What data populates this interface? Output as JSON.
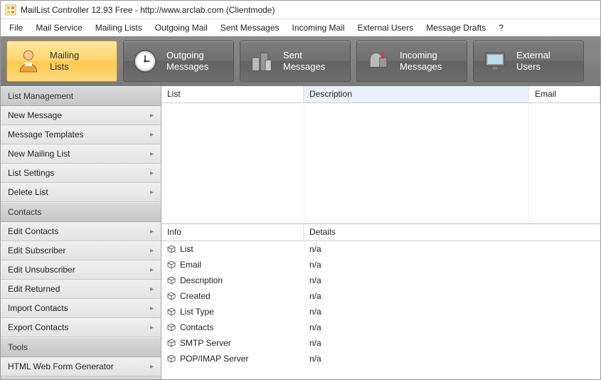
{
  "window": {
    "title": "MailList Controller 12.93 Free - http://www.arclab.com (Clientmode)"
  },
  "menubar": [
    "File",
    "Mail Service",
    "Mailing Lists",
    "Outgoing Mail",
    "Sent Messages",
    "Incoming Mail",
    "External Users",
    "Message Drafts",
    "?"
  ],
  "toolbar": [
    {
      "id": "mailing-lists",
      "line1": "Mailing",
      "line2": "Lists",
      "active": true
    },
    {
      "id": "outgoing-messages",
      "line1": "Outgoing",
      "line2": "Messages",
      "active": false
    },
    {
      "id": "sent-messages",
      "line1": "Sent",
      "line2": "Messages",
      "active": false
    },
    {
      "id": "incoming-messages",
      "line1": "Incoming",
      "line2": "Messages",
      "active": false
    },
    {
      "id": "external-users",
      "line1": "External",
      "line2": "Users",
      "active": false
    }
  ],
  "sidebar": {
    "sections": [
      {
        "header": "List Management",
        "items": [
          "New Message",
          "Message Templates",
          "New Mailing List",
          "List Settings",
          "Delete List"
        ]
      },
      {
        "header": "Contacts",
        "items": [
          "Edit Contacts",
          "Edit Subscriber",
          "Edit Unsubscriber",
          "Edit Returned",
          "Import Contacts",
          "Export Contacts"
        ]
      },
      {
        "header": "Tools",
        "items": [
          "HTML Web Form Generator"
        ]
      }
    ]
  },
  "table": {
    "columns": [
      "List",
      "Description",
      "Email"
    ]
  },
  "details": {
    "columns": [
      "Info",
      "Details"
    ],
    "rows": [
      {
        "info": "List",
        "details": "n/a"
      },
      {
        "info": "Email",
        "details": "n/a"
      },
      {
        "info": "Description",
        "details": "n/a"
      },
      {
        "info": "Created",
        "details": "n/a"
      },
      {
        "info": "List Type",
        "details": "n/a"
      },
      {
        "info": "Contacts",
        "details": "n/a"
      },
      {
        "info": "SMTP Server",
        "details": "n/a"
      },
      {
        "info": "POP/IMAP Server",
        "details": "n/a"
      }
    ]
  }
}
